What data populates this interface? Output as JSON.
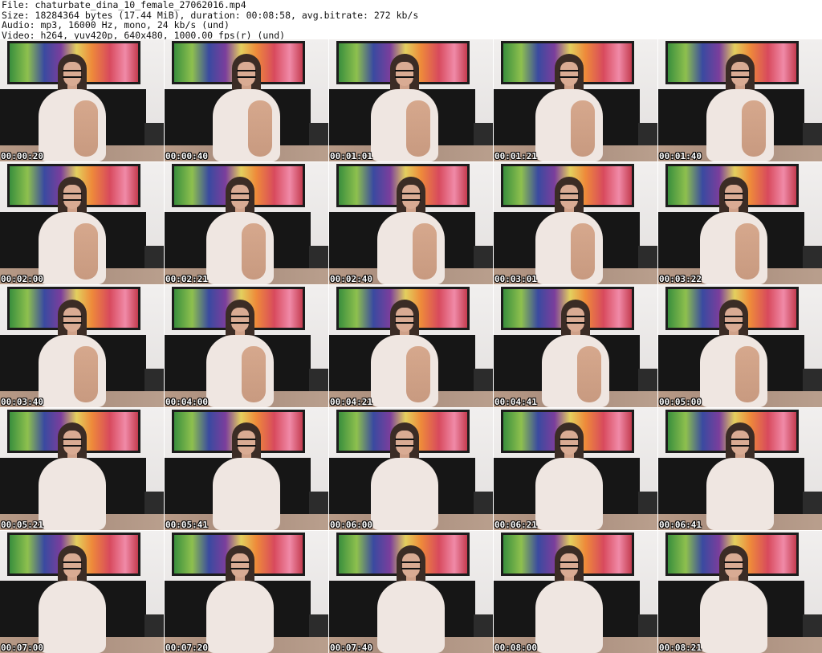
{
  "header": {
    "file_line": "File: chaturbate_dina_10_female_27062016.mp4",
    "size_line": "Size: 18284364 bytes (17.44 MiB), duration: 00:08:58, avg.bitrate: 272 kb/s",
    "audio_line": "Audio: mp3, 16000 Hz, mono, 24 kb/s (und)",
    "video_line": "Video: h264, yuv420p, 640x480, 1000.00 fps(r) (und)"
  },
  "thumbnails": [
    {
      "timestamp": "00:00:20"
    },
    {
      "timestamp": "00:00:40"
    },
    {
      "timestamp": "00:01:01"
    },
    {
      "timestamp": "00:01:21"
    },
    {
      "timestamp": "00:01:40"
    },
    {
      "timestamp": "00:02:00"
    },
    {
      "timestamp": "00:02:21"
    },
    {
      "timestamp": "00:02:40"
    },
    {
      "timestamp": "00:03:01"
    },
    {
      "timestamp": "00:03:22"
    },
    {
      "timestamp": "00:03:40"
    },
    {
      "timestamp": "00:04:00"
    },
    {
      "timestamp": "00:04:21"
    },
    {
      "timestamp": "00:04:41"
    },
    {
      "timestamp": "00:05:00"
    },
    {
      "timestamp": "00:05:21"
    },
    {
      "timestamp": "00:05:41"
    },
    {
      "timestamp": "00:06:00"
    },
    {
      "timestamp": "00:06:21"
    },
    {
      "timestamp": "00:06:41"
    },
    {
      "timestamp": "00:07:00"
    },
    {
      "timestamp": "00:07:20"
    },
    {
      "timestamp": "00:07:40"
    },
    {
      "timestamp": "00:08:00"
    },
    {
      "timestamp": "00:08:21"
    }
  ]
}
